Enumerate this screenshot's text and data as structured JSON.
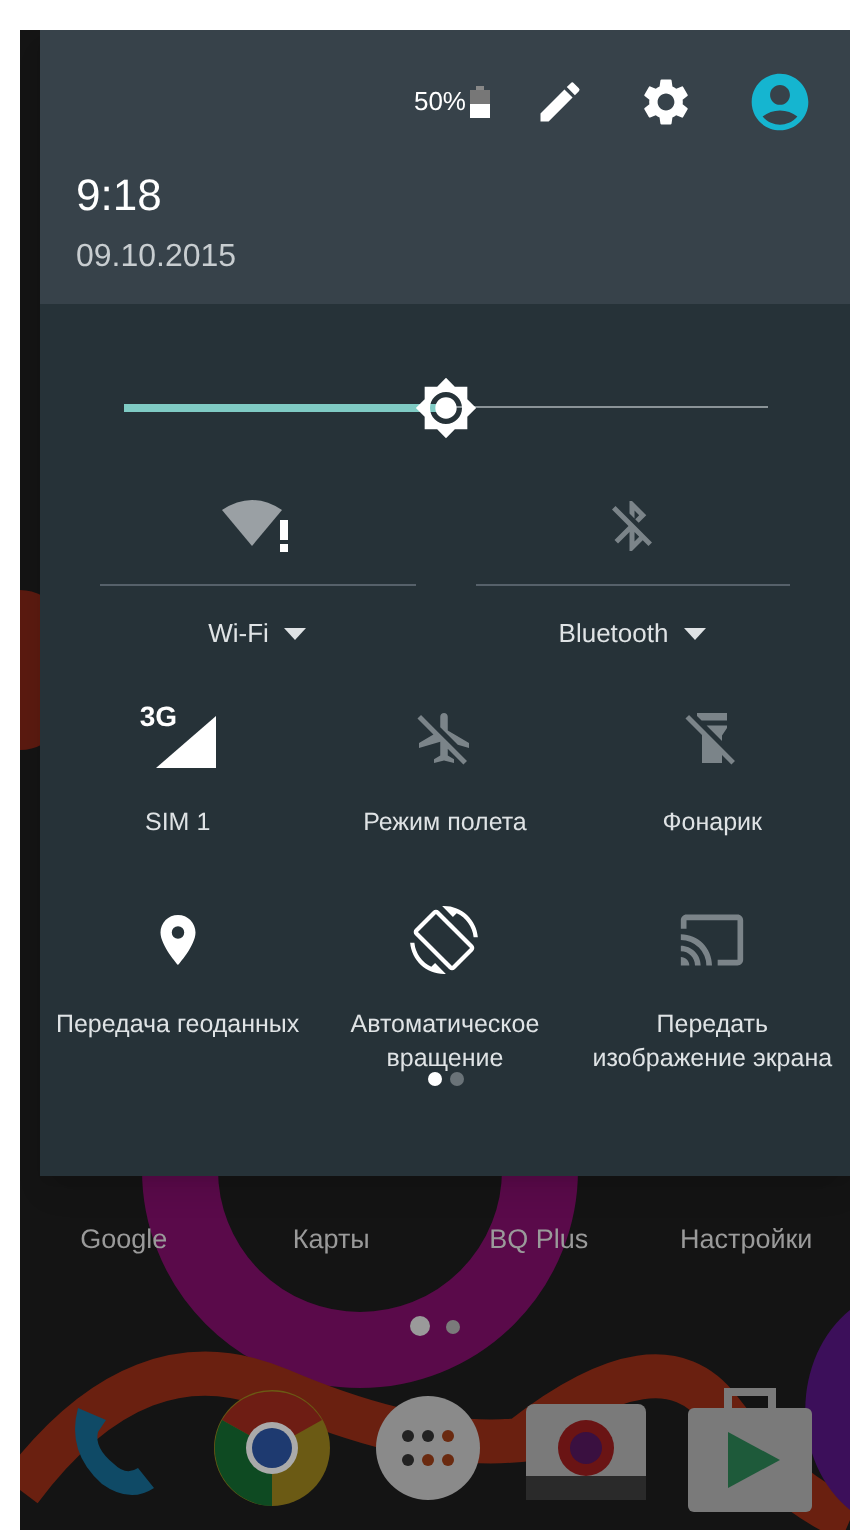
{
  "header": {
    "battery": "50%",
    "time": "9:18",
    "date": "09.10.2015"
  },
  "brightness": {
    "level": 0.5
  },
  "big_tiles": [
    {
      "kind": "wifi",
      "label": "Wi-Fi",
      "active": true
    },
    {
      "kind": "bluetooth",
      "label": "Bluetooth",
      "active": false
    }
  ],
  "tiles": [
    {
      "kind": "cellular",
      "label": "SIM 1",
      "network": "3G",
      "active": true
    },
    {
      "kind": "airplane",
      "label": "Режим полета",
      "active": false
    },
    {
      "kind": "flashlight",
      "label": "Фонарик",
      "active": false
    },
    {
      "kind": "location",
      "label": "Передача геоданных",
      "active": true
    },
    {
      "kind": "rotation",
      "label": "Автоматическое вращение",
      "active": true
    },
    {
      "kind": "cast",
      "label": "Передать изображение экрана",
      "active": false
    }
  ],
  "panel_pages": [
    {
      "selected": true
    },
    {
      "selected": false
    }
  ],
  "home_apps": [
    {
      "label": "Google"
    },
    {
      "label": "Карты"
    },
    {
      "label": "BQ Plus"
    },
    {
      "label": "Настройки"
    }
  ],
  "home_pages": [
    {
      "selected": true
    },
    {
      "selected": false
    }
  ]
}
